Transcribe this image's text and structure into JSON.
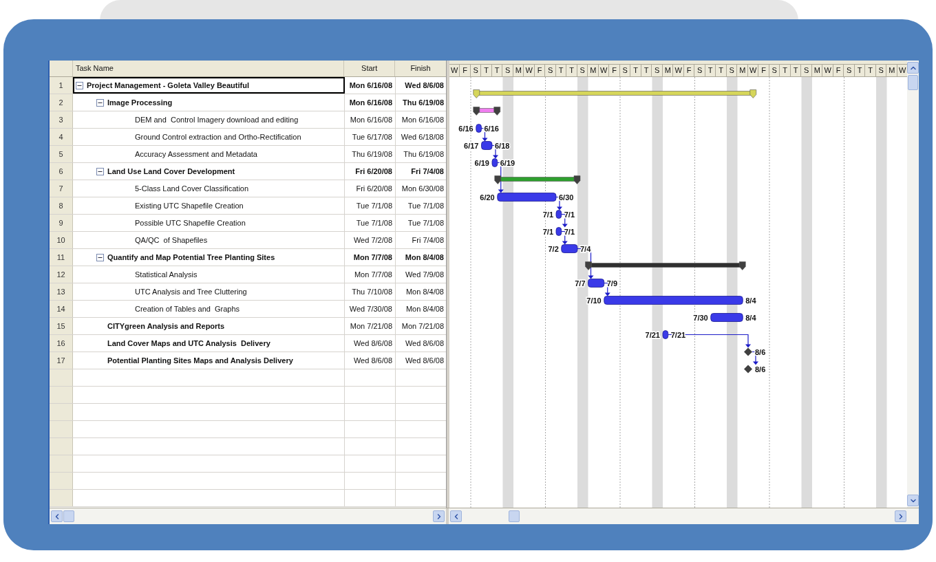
{
  "table": {
    "columns": [
      "Task Name",
      "Start",
      "Finish"
    ],
    "rows": [
      {
        "number": "1",
        "name": "Project Management - Goleta Valley Beautiful",
        "start": "Mon 6/16/08",
        "finish": "Wed 8/6/08",
        "kind": "summary",
        "expanded": true,
        "bold": true,
        "selected": true,
        "color": "#d6d65a",
        "children": [
          {
            "number": "2",
            "name": "Image Processing",
            "start": "Mon 6/16/08",
            "finish": "Thu 6/19/08",
            "kind": "summary",
            "expanded": true,
            "bold": true,
            "selected": false,
            "color": "#f07ef0",
            "children": [
              {
                "number": "3",
                "name": "DEM and  Control Imagery download and editing",
                "start": "Mon 6/16/08",
                "finish": "Mon 6/16/08",
                "kind": "task",
                "expanded": false,
                "bold": false,
                "selected": false,
                "color": "#3a3ae8",
                "bar_start_label": "6/16",
                "bar_finish_label": "6/16"
              },
              {
                "number": "4",
                "name": "Ground Control extraction and Ortho-Rectification",
                "start": "Tue 6/17/08",
                "finish": "Wed 6/18/08",
                "kind": "task",
                "expanded": false,
                "bold": false,
                "selected": false,
                "color": "#3a3ae8",
                "bar_start_label": "6/17",
                "bar_finish_label": "6/18"
              },
              {
                "number": "5",
                "name": "Accuracy Assessment and Metadata",
                "start": "Thu 6/19/08",
                "finish": "Thu 6/19/08",
                "kind": "task",
                "expanded": false,
                "bold": false,
                "selected": false,
                "color": "#3a3ae8",
                "bar_start_label": "6/19",
                "bar_finish_label": "6/19"
              }
            ]
          },
          {
            "number": "6",
            "name": "Land Use Land Cover Development",
            "start": "Fri 6/20/08",
            "finish": "Fri 7/4/08",
            "kind": "summary",
            "expanded": true,
            "bold": true,
            "selected": false,
            "color": "#2ea02e",
            "children": [
              {
                "number": "7",
                "name": "5-Class Land Cover Classification",
                "start": "Fri 6/20/08",
                "finish": "Mon 6/30/08",
                "kind": "task",
                "expanded": false,
                "bold": false,
                "selected": false,
                "color": "#3a3ae8",
                "bar_start_label": "6/20",
                "bar_finish_label": "6/30"
              },
              {
                "number": "8",
                "name": "Existing UTC Shapefile Creation",
                "start": "Tue 7/1/08",
                "finish": "Tue 7/1/08",
                "kind": "task",
                "expanded": false,
                "bold": false,
                "selected": false,
                "color": "#3a3ae8",
                "bar_start_label": "7/1",
                "bar_finish_label": "7/1"
              },
              {
                "number": "9",
                "name": "Possible UTC Shapefile Creation",
                "start": "Tue 7/1/08",
                "finish": "Tue 7/1/08",
                "kind": "task",
                "expanded": false,
                "bold": false,
                "selected": false,
                "color": "#3a3ae8",
                "bar_start_label": "7/1",
                "bar_finish_label": "7/1"
              },
              {
                "number": "10",
                "name": "QA/QC  of Shapefiles",
                "start": "Wed 7/2/08",
                "finish": "Fri 7/4/08",
                "kind": "task",
                "expanded": false,
                "bold": false,
                "selected": false,
                "color": "#3a3ae8",
                "bar_start_label": "7/2",
                "bar_finish_label": "7/4"
              }
            ]
          },
          {
            "number": "11",
            "name": "Quantify and Map Potential Tree Planting Sites",
            "start": "Mon 7/7/08",
            "finish": "Mon 8/4/08",
            "kind": "summary",
            "expanded": true,
            "bold": true,
            "selected": false,
            "color": "#303030",
            "children": [
              {
                "number": "12",
                "name": "Statistical Analysis",
                "start": "Mon 7/7/08",
                "finish": "Wed 7/9/08",
                "kind": "task",
                "expanded": false,
                "bold": false,
                "selected": false,
                "color": "#3a3ae8",
                "bar_start_label": "7/7",
                "bar_finish_label": "7/9"
              },
              {
                "number": "13",
                "name": "UTC Analysis and Tree Cluttering",
                "start": "Thu 7/10/08",
                "finish": "Mon 8/4/08",
                "kind": "task",
                "expanded": false,
                "bold": false,
                "selected": false,
                "color": "#3a3ae8",
                "bar_start_label": "7/10",
                "bar_finish_label": "8/4"
              },
              {
                "number": "14",
                "name": "Creation of Tables and  Graphs",
                "start": "Wed 7/30/08",
                "finish": "Mon 8/4/08",
                "kind": "task",
                "expanded": false,
                "bold": false,
                "selected": false,
                "color": "#3a3ae8",
                "bar_start_label": "7/30",
                "bar_finish_label": "8/4"
              }
            ]
          },
          {
            "number": "15",
            "name": "CITYgreen Analysis and Reports",
            "start": "Mon 7/21/08",
            "finish": "Mon 7/21/08",
            "kind": "task",
            "expanded": false,
            "bold": true,
            "selected": false,
            "color": "#3a3ae8",
            "bar_start_label": "7/21",
            "bar_finish_label": "7/21"
          },
          {
            "number": "16",
            "name": "Land Cover Maps and UTC Analysis  Delivery",
            "start": "Wed 8/6/08",
            "finish": "Wed 8/6/08",
            "kind": "milestone",
            "expanded": false,
            "bold": true,
            "selected": false,
            "color": "#404040",
            "bar_finish_label": "8/6"
          },
          {
            "number": "17",
            "name": "Potential Planting Sites Maps and Analysis Delivery",
            "start": "Wed 8/6/08",
            "finish": "Wed 8/6/08",
            "kind": "milestone",
            "expanded": false,
            "bold": true,
            "selected": false,
            "color": "#404040",
            "bar_finish_label": "8/6"
          }
        ]
      }
    ]
  },
  "timescale": [
    "W",
    "F",
    "S",
    "T",
    "T",
    "S",
    "M",
    "W",
    "F",
    "S",
    "T",
    "T",
    "S",
    "M",
    "W",
    "F",
    "S",
    "T",
    "T",
    "S",
    "M",
    "W",
    "F",
    "S",
    "T",
    "T",
    "S",
    "M",
    "W",
    "F",
    "S",
    "T",
    "T",
    "S",
    "M",
    "W",
    "F",
    "S",
    "T",
    "T",
    "S",
    "M",
    "W"
  ]
}
